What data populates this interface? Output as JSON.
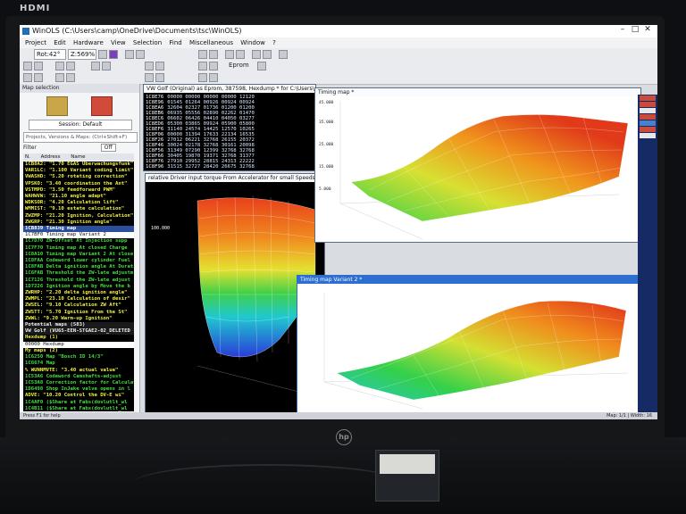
{
  "monitor": {
    "input_label": "HDMI",
    "brand_mark": "hp"
  },
  "app": {
    "title": "WinOLS (C:\\Users\\camp\\OneDrive\\Documents\\tsc\\WinOLS)",
    "menu": [
      "Project",
      "Edit",
      "Hardware",
      "View",
      "Selection",
      "Find",
      "Miscellaneous",
      "Window",
      "?"
    ],
    "toolbar": {
      "mode": "Rot:42°",
      "zoom": "Z:569%",
      "eprom_button": "Eprom"
    }
  },
  "left_panel": {
    "title": "Map selection",
    "session_label": "Session: Default",
    "search_placeholder": "Projects, Versions & Maps: (Ctrl+Shift+F)",
    "filter_label": "Filter",
    "filter_value": "Off",
    "columns": [
      "N.",
      "Address",
      "Name"
    ],
    "rows": [
      {
        "cls": "y",
        "text": "1CB8A2: \"1.70 EGAS Überwachungsfunk\""
      },
      {
        "cls": "y",
        "text": "VAR1LC: \"1.100 Variant coding limit\""
      },
      {
        "cls": "y",
        "text": "VWASHD: \"5.20 rotating correction\""
      },
      {
        "cls": "y",
        "text": "VPSKO: \"3.40 coordination the Ant\""
      },
      {
        "cls": "y",
        "text": "VSTMPD: \"3.50 feedforward PWM\""
      },
      {
        "cls": "y",
        "text": "WAHWVW: \"21.10 angle adapt\""
      },
      {
        "cls": "y",
        "text": "WDKSOR: \"4.20 Calculation lift\""
      },
      {
        "cls": "y",
        "text": "WMMIST: \"9.10 estate calculation\""
      },
      {
        "cls": "y",
        "text": "ZWZMP: \"21.20 Ignition, Calculation\""
      },
      {
        "cls": "y",
        "text": "ZWGRP: \"21.30 Ignition angle\""
      },
      {
        "cls": "sel",
        "text": "1CB839   Timing map"
      },
      {
        "cls": "w",
        "text": "1C7BF0   Timing map Variant 2"
      },
      {
        "cls": "g",
        "text": "1C7D70   ZW-Offset At Injection supp"
      },
      {
        "cls": "g",
        "text": "1C7F70   Timing map At closed Charge"
      },
      {
        "cls": "g",
        "text": "1C8A10   Timing map Variant 2 At close"
      },
      {
        "cls": "g",
        "text": "1C8FAA   Codeword lower cylinder Fuel"
      },
      {
        "cls": "g",
        "text": "1C8FAB   Delta ignition angle At Durati"
      },
      {
        "cls": "g",
        "text": "1C6FAB   Threshold the ZW-late adjustm"
      },
      {
        "cls": "g",
        "text": "1C7126   Threshold the ZW-late adjust"
      },
      {
        "cls": "g",
        "text": "1D7226   Ignition angle by Move the b"
      },
      {
        "cls": "y",
        "text": "ZWRHP: \"2.20 delta ignition angle\""
      },
      {
        "cls": "y",
        "text": "ZWMPL: \"23.10 Calculation of desir\""
      },
      {
        "cls": "y",
        "text": "ZWSEL: \"9.10 Calculation ZW Aft\""
      },
      {
        "cls": "y",
        "text": "ZWSTT: \"5.70 Ignition From the St\""
      },
      {
        "cls": "y",
        "text": "ZWWL: \"9.20 Warm-up Ignition\""
      },
      {
        "cls": "hdr",
        "text": "Potential maps (583)"
      },
      {
        "cls": "hdr",
        "text": "VW Golf (VU65-EEN-STGAE2-02_DELETED"
      },
      {
        "cls": "y",
        "text": "Hexdump (1)"
      },
      {
        "cls": "w",
        "text": "00000   Hexdump"
      },
      {
        "cls": "y",
        "text": "My maps (2)"
      },
      {
        "cls": "g",
        "text": "1C6250   Map \"Bosch ID 14/3\""
      },
      {
        "cls": "g",
        "text": "1C6674   Map"
      },
      {
        "cls": "y",
        "text": "% WUNNMVTE: \"3.40 actual value\""
      },
      {
        "cls": "g",
        "text": "1C53A6   Codeword Camshafts-adjust"
      },
      {
        "cls": "g",
        "text": "1C53A8   Correction factor for Calculat"
      },
      {
        "cls": "g",
        "text": "1D6498   Shop InJake valve opens in l"
      },
      {
        "cls": "y",
        "text": "ADVE: \"10.20 Control the DV-E wi\""
      },
      {
        "cls": "g",
        "text": "1C4AF0   ($Share at Fabs(dovlutlt_wl"
      },
      {
        "cls": "g",
        "text": "1C4B11   ($Share at Fabs(dovlutlt_wl"
      },
      {
        "cls": "g",
        "text": "1C4851   ($Share at Fabs(dovlutlt_wl"
      },
      {
        "cls": "g",
        "text": "1C4B51   ($Share at Fabs(dovlutlt_wl"
      },
      {
        "cls": "g",
        "text": "1C4B51   ($Share at Fabs(dovlutlt_wl"
      }
    ]
  },
  "hex_window": {
    "title": "VW Golf (Original) as Eprom, 387598, Hexdump * for C:\\Users\\c",
    "rows": [
      {
        "addr": "1C8E76",
        "vals": "00000 00000 00000 00000 12120"
      },
      {
        "addr": "1C8E96",
        "vals": "01545 01264 00926 00924 00924"
      },
      {
        "addr": "1C8EA6",
        "vals": "32604 02327 01736 01200 01200"
      },
      {
        "addr": "1C8EB6",
        "vals": "06935 05556 02890 02262 01470"
      },
      {
        "addr": "1C8EC6",
        "vals": "06602 06426 04410 04050 03277"
      },
      {
        "addr": "1C8ED6",
        "vals": "05300 03865 09924 05900 05800"
      },
      {
        "addr": "1C8EF6",
        "vals": "31140 24574 14425 12570 10265"
      },
      {
        "addr": "1C8F06",
        "vals": "00000 31394 17633 22134 16535"
      },
      {
        "addr": "1C8F26",
        "vals": "27012 06221 32768 26155 20372"
      },
      {
        "addr": "1C8F46",
        "vals": "30024 02178 32768 30161 20098"
      },
      {
        "addr": "1C8F56",
        "vals": "31349 07290 12399 32768 32768"
      },
      {
        "addr": "1C8F66",
        "vals": "30405 19870 19371 32768 31377"
      },
      {
        "addr": "1C8F76",
        "vals": "27910 29952 28815 24313 22222"
      },
      {
        "addr": "1C8F96",
        "vals": "31515 32727 28420 26675 32768"
      }
    ]
  },
  "timing_map_window": {
    "title": "Timing map *"
  },
  "driver_torque_window": {
    "title": "relative Driver input torque From Accelerator for small Speeds *"
  },
  "timing_map_variant_window": {
    "title": "Timing map Variant 2 *"
  },
  "status_bar": {
    "left": "Press F1 for help",
    "right": "Map: 1/1 | Width: 16"
  },
  "colors": {
    "list_bg": "#000000",
    "hex_text": "#d8e6ff",
    "accent": "#2c6fd0"
  }
}
